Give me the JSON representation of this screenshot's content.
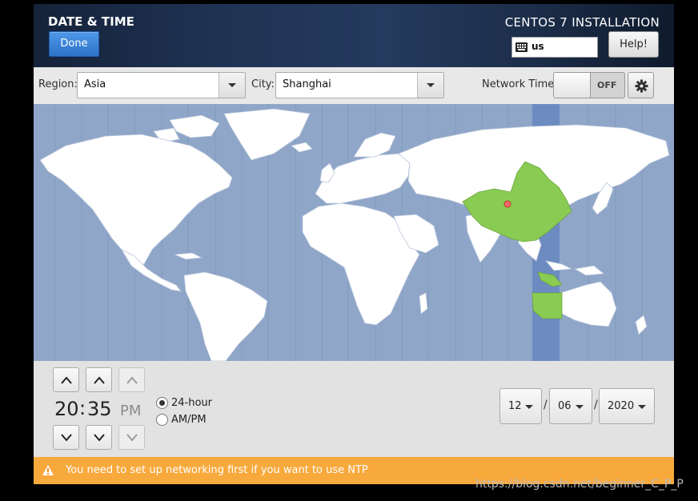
{
  "header": {
    "screen_title": "DATE & TIME",
    "done_label": "Done",
    "product_title": "CENTOS 7 INSTALLATION",
    "keyboard_layout": "us",
    "help_label": "Help!"
  },
  "toolbar": {
    "region_label": "Region:",
    "region_value": "Asia",
    "city_label": "City:",
    "city_value": "Shanghai",
    "network_time_label": "Network Time",
    "network_time_state": "OFF",
    "network_time_on": false
  },
  "map": {
    "selected_timezone": "Asia/Shanghai",
    "colors": {
      "ocean": "#8fa6c8",
      "land": "#ffffff",
      "selected_region": "#8acb53",
      "timezone_band": "#6c8bc0",
      "pin": "#ef6a6a"
    }
  },
  "time": {
    "hours": "20",
    "separator": ":",
    "minutes": "35",
    "ampm": "PM",
    "format_24_label": "24-hour",
    "format_ampm_label": "AM/PM",
    "format_selected": "24-hour"
  },
  "date": {
    "month": "12",
    "day": "06",
    "year": "2020",
    "separator": "/"
  },
  "warning": {
    "text": "You need to set up networking first if you want to use NTP",
    "color": "#f8a93c"
  },
  "watermark": "https://blog.csdn.net/beginner_C_P_P"
}
